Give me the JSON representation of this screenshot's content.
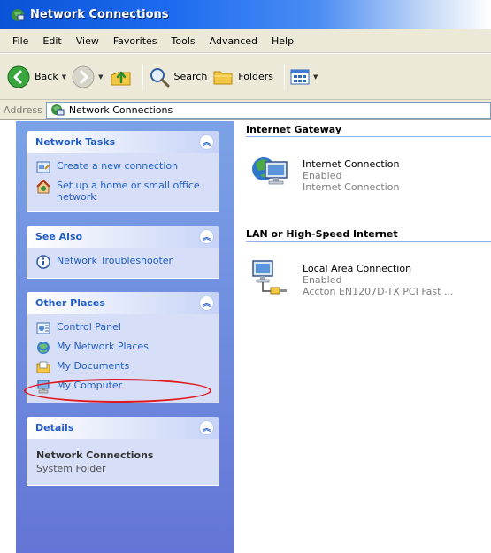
{
  "window": {
    "title": "Network Connections"
  },
  "menu": [
    "File",
    "Edit",
    "View",
    "Favorites",
    "Tools",
    "Advanced",
    "Help"
  ],
  "toolbar": {
    "back": "Back",
    "search": "Search",
    "folders": "Folders"
  },
  "address": {
    "label": "Address",
    "value": "Network Connections"
  },
  "panels": {
    "network_tasks": {
      "title": "Network Tasks",
      "items": [
        "Create a new connection",
        "Set up a home or small office network"
      ]
    },
    "see_also": {
      "title": "See Also",
      "items": [
        "Network Troubleshooter"
      ]
    },
    "other_places": {
      "title": "Other Places",
      "items": [
        "Control Panel",
        "My Network Places",
        "My Documents",
        "My Computer"
      ]
    },
    "details": {
      "title": "Details",
      "name": "Network Connections",
      "type": "System Folder"
    }
  },
  "groups": [
    {
      "title": "Internet Gateway",
      "item": {
        "name": "Internet Connection",
        "status": "Enabled",
        "description": "Internet Connection"
      }
    },
    {
      "title": "LAN or High-Speed Internet",
      "item": {
        "name": "Local Area Connection",
        "status": "Enabled",
        "description": "Accton EN1207D-TX PCI Fast ..."
      }
    }
  ],
  "colors": {
    "link": "#215dc6",
    "annotation": "#e1191e",
    "pane_top": "#7ba2e7",
    "pane_bottom": "#6375d6"
  }
}
